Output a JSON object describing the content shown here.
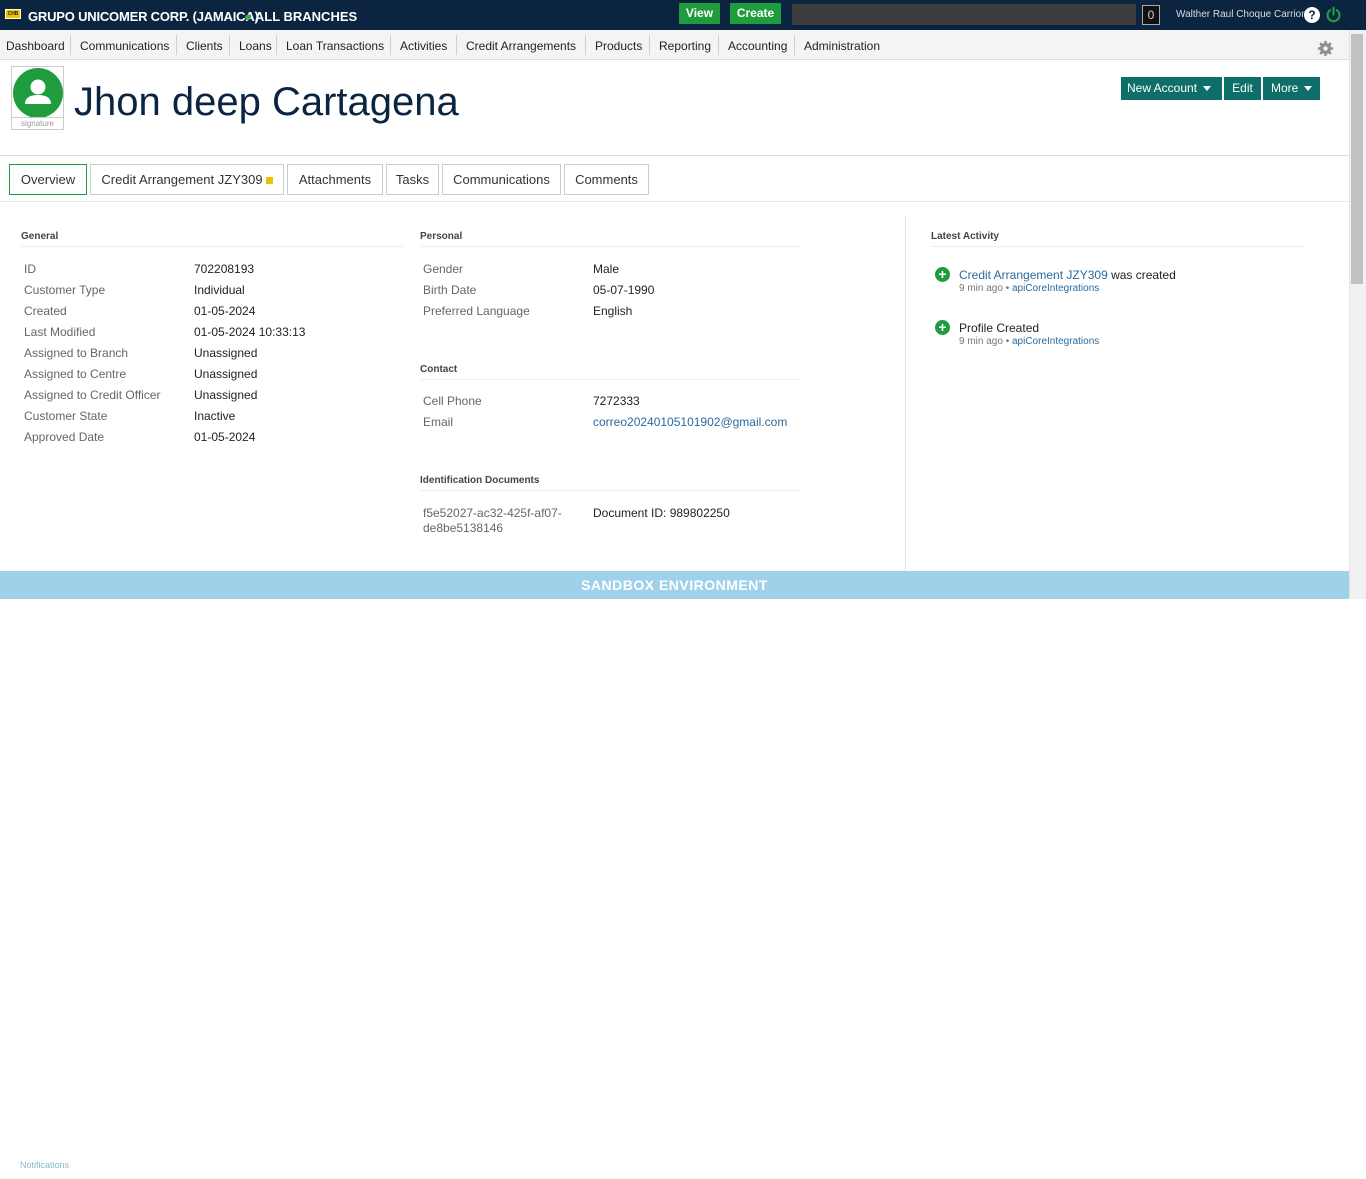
{
  "topbar": {
    "logo_text": "CHB",
    "org_name": "GRUPO UNICOMER CORP. (JAMAICA)",
    "branch": "ALL BRANCHES",
    "view_label": "View",
    "create_label": "Create",
    "search_value": "",
    "counter": "0",
    "user_name": "Walther Raul Choque Carrion",
    "help_glyph": "?",
    "accent": "#1f9d3e",
    "bar_color": "#0b2540"
  },
  "nav": {
    "items": [
      "Dashboard",
      "Communications",
      "Clients",
      "Loans",
      "Loan Transactions",
      "Activities",
      "Credit Arrangements",
      "Products",
      "Reporting",
      "Accounting",
      "Administration"
    ]
  },
  "profile": {
    "name": "Jhon deep Cartagena",
    "signature_label": "signature"
  },
  "actions": {
    "new_account": "New Account",
    "edit": "Edit",
    "more": "More"
  },
  "tabs": [
    "Overview",
    "Credit Arrangement JZY309",
    "Attachments",
    "Tasks",
    "Communications",
    "Comments"
  ],
  "general": {
    "title": "General",
    "rows": [
      {
        "label": "ID",
        "value": "702208193"
      },
      {
        "label": "Customer Type",
        "value": "Individual"
      },
      {
        "label": "Created",
        "value": "01-05-2024"
      },
      {
        "label": "Last Modified",
        "value": "01-05-2024 10:33:13"
      },
      {
        "label": "Assigned to Branch",
        "value": "Unassigned"
      },
      {
        "label": "Assigned to Centre",
        "value": "Unassigned"
      },
      {
        "label": "Assigned to Credit Officer",
        "value": "Unassigned"
      },
      {
        "label": "Customer State",
        "value": "Inactive"
      },
      {
        "label": "Approved Date",
        "value": "01-05-2024"
      }
    ]
  },
  "personal": {
    "title": "Personal",
    "rows": [
      {
        "label": "Gender",
        "value": "Male"
      },
      {
        "label": "Birth Date",
        "value": "05-07-1990"
      },
      {
        "label": "Preferred Language",
        "value": "English"
      }
    ]
  },
  "contact": {
    "title": "Contact",
    "rows": [
      {
        "label": "Cell Phone",
        "value": "7272333"
      },
      {
        "label": "Email",
        "value": "correo20240105101902@gmail.com"
      }
    ]
  },
  "identification": {
    "title": "Identification Documents",
    "doc_line1": "f5e52027-ac32-425f-af07-",
    "doc_line2": "de8be5138146",
    "doc_value": "Document ID: 989802250"
  },
  "activity": {
    "title": "Latest Activity",
    "items": [
      {
        "link": "Credit Arrangement JZY309",
        "text": " was created",
        "time": "9 min ago",
        "sep": " • ",
        "user": "apiCoreIntegrations"
      },
      {
        "link": "",
        "text": "Profile Created",
        "time": "9 min ago",
        "sep": " • ",
        "user": "apiCoreIntegrations"
      }
    ]
  },
  "footer": {
    "sandbox": "SANDBOX ENVIRONMENT",
    "notifications": "Notifications"
  }
}
